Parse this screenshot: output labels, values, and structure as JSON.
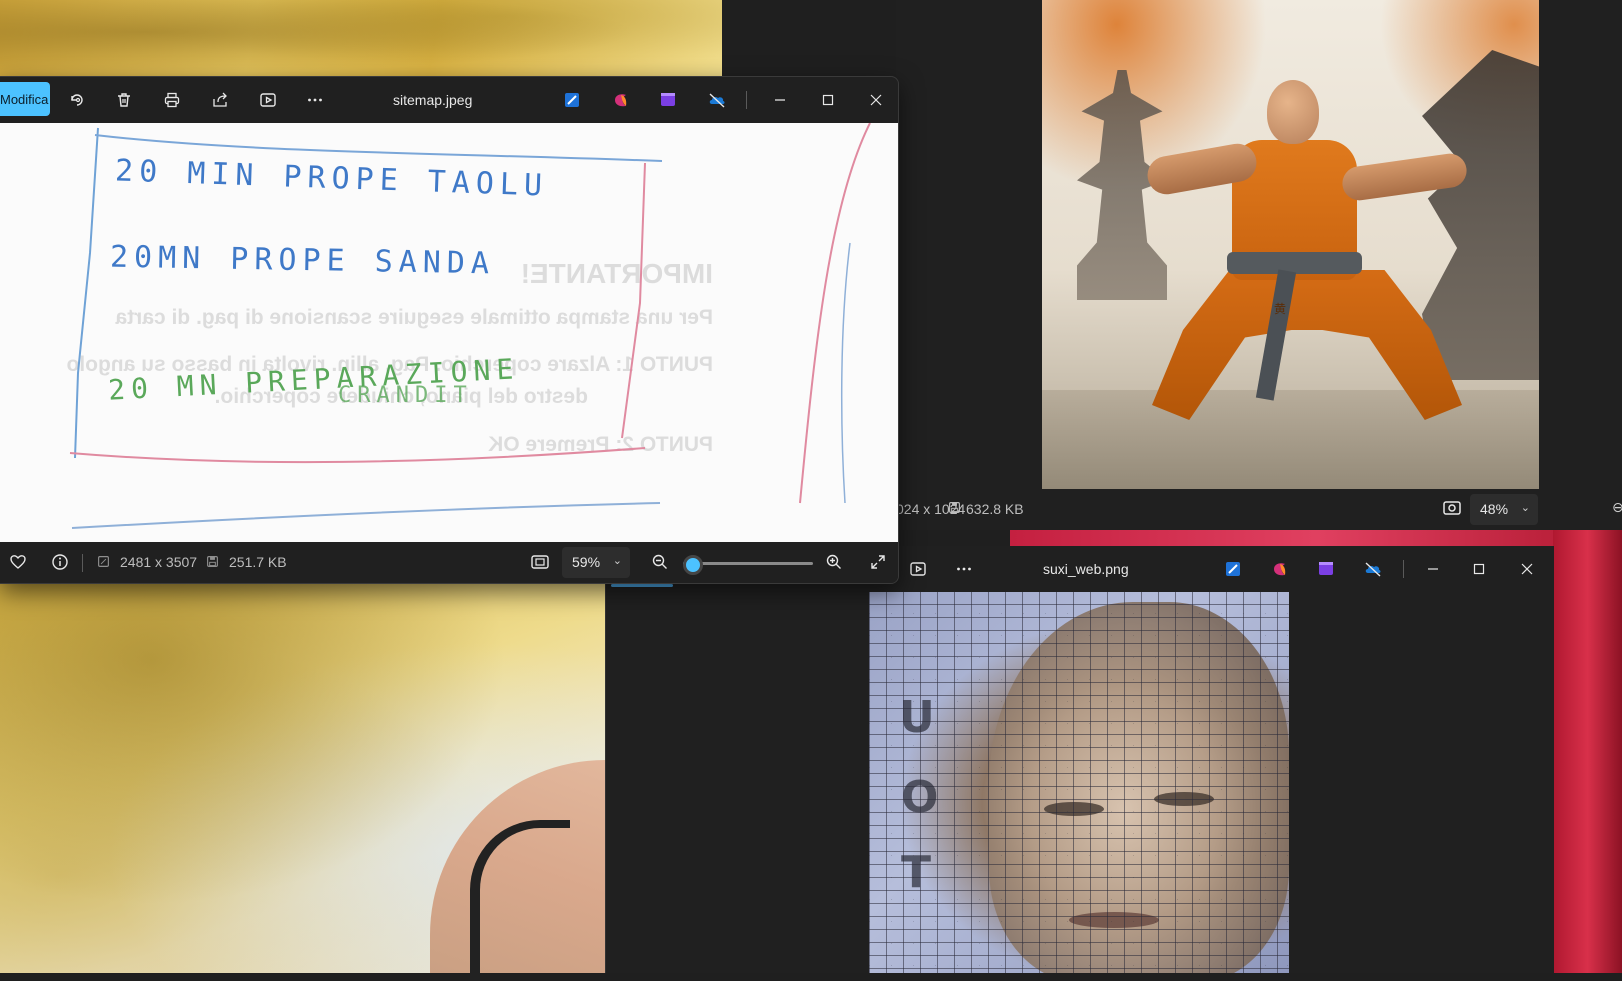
{
  "colors": {
    "accent": "#4cc2ff",
    "window_bg": "#202020",
    "zoom_bg": "#2d2d2d",
    "text_primary": "#e8e8e8",
    "text_secondary": "#bdbdbd"
  },
  "sitemap_window": {
    "edit_label": "Modifica",
    "title": "sitemap.jpeg",
    "toolbar_icons": [
      "rotate-icon",
      "trash-icon",
      "print-icon",
      "share-icon",
      "slideshow-icon",
      "more-icon"
    ],
    "app_icons": [
      "photo-edit-app-icon",
      "designer-app-icon",
      "clipchamp-app-icon",
      "onedrive-app-icon"
    ],
    "image": {
      "handwriting": [
        "20 MIN PROPE TAOLU",
        "20MN PROPE SANDA",
        "20 MN PREPARAZIONE",
        "CRANDIT"
      ],
      "ghost_text": [
        "IMPORTANTE!",
        "Per una stampa ottimale eseguire scansione di pag. di carta",
        "PUNTO 1: Alzare coperchio. Pag. allin. rivolta in basso su angolo",
        "destro del piano, chiudere coperchio.",
        "PUNTO 2: Premere OK"
      ]
    },
    "status": {
      "dimensions": "2481 x 3507",
      "file_size": "251.7 KB",
      "zoom": "59%",
      "zoom_level": 0.08
    }
  },
  "monk_window": {
    "status": {
      "dimensions": "024 x 1024",
      "file_size": "632.8 KB",
      "zoom": "48%",
      "trailing_glyph": "⊖"
    },
    "image": {
      "emblem": "黄"
    }
  },
  "suxi_window": {
    "title": "suxi_web.png",
    "toolbar_icons": [
      "slideshow-icon",
      "more-icon"
    ],
    "app_icons": [
      "photo-edit-app-icon",
      "designer-app-icon",
      "clipchamp-app-icon",
      "onedrive-app-icon"
    ],
    "image": {
      "glyphs": [
        "U",
        "O",
        "T"
      ]
    }
  }
}
